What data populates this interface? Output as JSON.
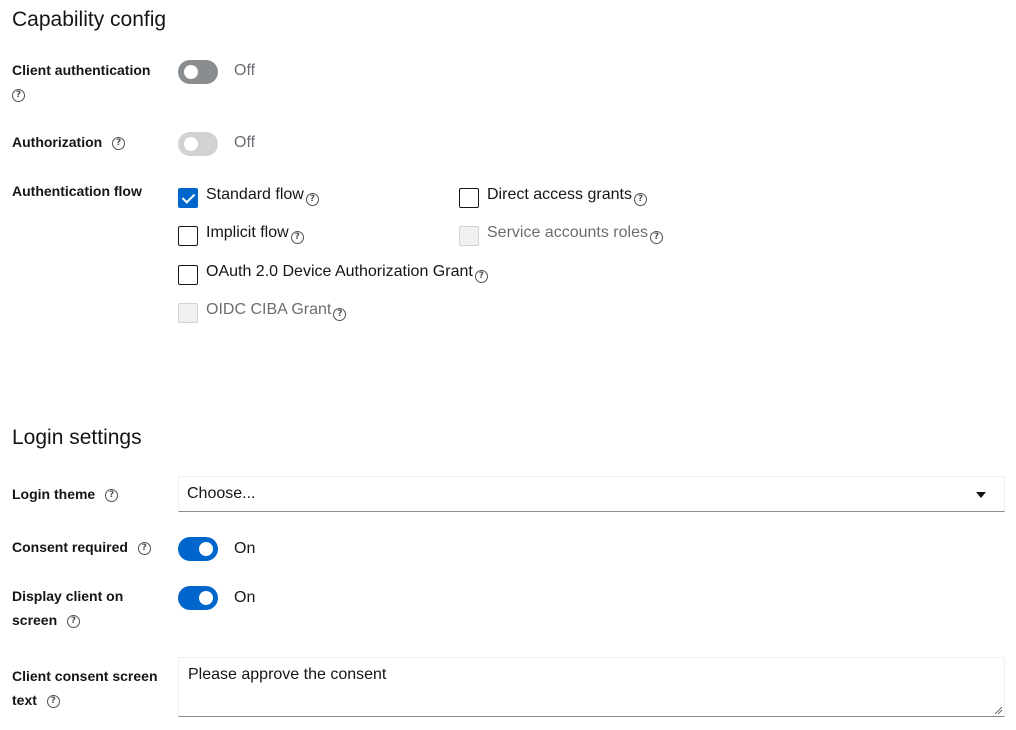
{
  "capability": {
    "title": "Capability config",
    "client_auth": {
      "label": "Client authentication",
      "state": "Off"
    },
    "authorization": {
      "label": "Authorization",
      "state": "Off"
    },
    "auth_flow": {
      "label": "Authentication flow",
      "options": {
        "standard": {
          "label": "Standard flow",
          "checked": true
        },
        "direct": {
          "label": "Direct access grants",
          "checked": false
        },
        "implicit": {
          "label": "Implicit flow",
          "checked": false
        },
        "service": {
          "label": "Service accounts roles",
          "checked": false,
          "disabled": true
        },
        "device": {
          "label": "OAuth 2.0 Device Authorization Grant",
          "checked": false
        },
        "ciba": {
          "label": "OIDC CIBA Grant",
          "checked": false,
          "disabled": true
        }
      }
    }
  },
  "login": {
    "title": "Login settings",
    "theme": {
      "label": "Login theme",
      "value": "Choose..."
    },
    "consent": {
      "label": "Consent required",
      "state": "On"
    },
    "display_client": {
      "label_line1": "Display client on",
      "label_line2": "screen",
      "state": "On"
    },
    "consent_text": {
      "label_line1": "Client consent screen",
      "label_line2": "text",
      "value": "Please approve the consent"
    }
  },
  "colors": {
    "accent": "#0066cc",
    "switch_off": "#8a8d90",
    "disabled": "#d2d2d2"
  }
}
